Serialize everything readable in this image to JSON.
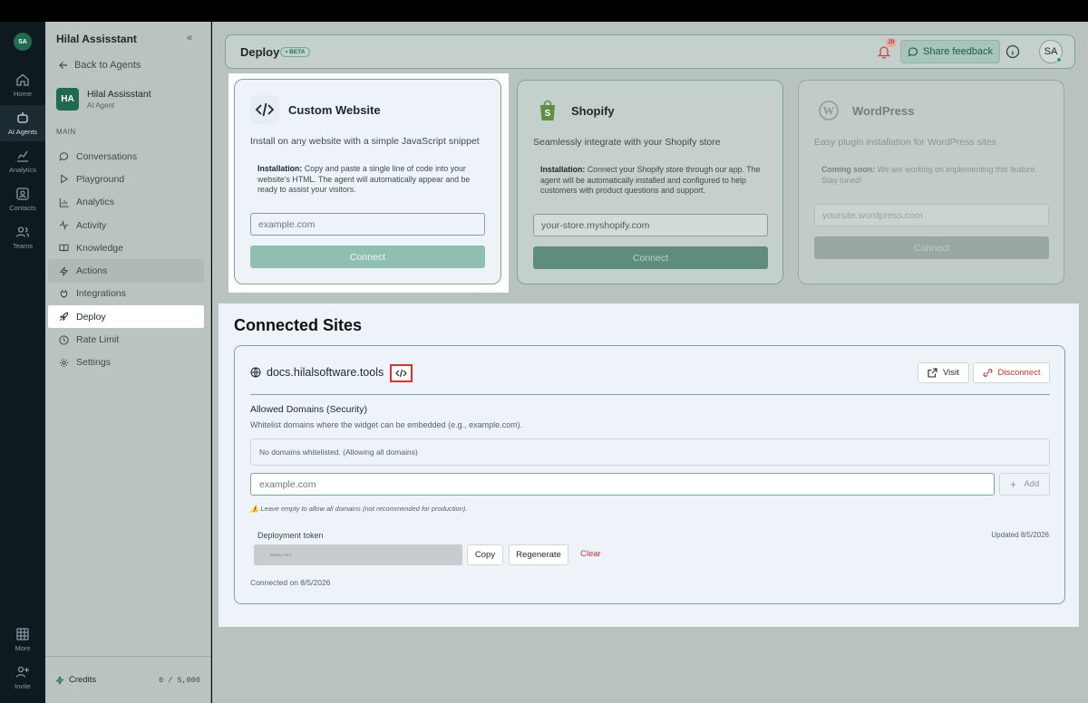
{
  "rail": {
    "logo": "SA",
    "items": [
      {
        "label": "Home",
        "icon": "home-icon"
      },
      {
        "label": "AI Agents",
        "icon": "robot-icon"
      },
      {
        "label": "Analytics",
        "icon": "chart-line-icon"
      },
      {
        "label": "Contacts",
        "icon": "contact-card-icon"
      },
      {
        "label": "Teams",
        "icon": "users-icon"
      },
      {
        "label": "More",
        "icon": "grid-icon"
      },
      {
        "label": "Invite",
        "icon": "user-plus-icon"
      }
    ]
  },
  "sidebar": {
    "title": "Hilal Assisstant",
    "back": "Back to Agents",
    "agent_initials": "HA",
    "agent_name": "Hilal Assisstant",
    "agent_sub": "AI Agent",
    "section": "MAIN",
    "items": [
      {
        "label": "Conversations",
        "icon": "chat-icon"
      },
      {
        "label": "Playground",
        "icon": "play-icon"
      },
      {
        "label": "Analytics",
        "icon": "bar-chart-icon"
      },
      {
        "label": "Activity",
        "icon": "activity-icon"
      },
      {
        "label": "Knowledge",
        "icon": "book-icon"
      },
      {
        "label": "Actions",
        "icon": "lightning-icon"
      },
      {
        "label": "Integrations",
        "icon": "plug-icon"
      },
      {
        "label": "Deploy",
        "icon": "rocket-icon"
      },
      {
        "label": "Rate Limit",
        "icon": "clock-icon"
      },
      {
        "label": "Settings",
        "icon": "gear-icon"
      }
    ],
    "active": "Deploy",
    "credits_label": "Credits",
    "credits_value": "0 / 5,000"
  },
  "header": {
    "title": "Deploy",
    "badge": "• BETA",
    "notification_count": "29",
    "feedback_label": "Share feedback",
    "user_initials": "SA"
  },
  "integrations": [
    {
      "name": "Custom Website",
      "icon": "code-icon",
      "description": "Install on any website with a simple JavaScript snippet",
      "instruction_label": "Installation:",
      "instruction_text": " Copy and paste a single line of code into your website's HTML. The agent will automatically appear and be ready to assist your visitors.",
      "placeholder": "example.com",
      "button": "Connect"
    },
    {
      "name": "Shopify",
      "icon": "shopify-bag-icon",
      "description": "Seamlessly integrate with your Shopify store",
      "instruction_label": "Installation:",
      "instruction_text": " Connect your Shopify store through our app. The agent will be automatically installed and configured to help customers with product questions and support.",
      "placeholder": "your-store.myshopify.com",
      "button": "Connect"
    },
    {
      "name": "WordPress",
      "icon": "wordpress-icon",
      "description": "Easy plugin installation for WordPress sites",
      "instruction_label": "Coming soon:",
      "instruction_text": " We are working on implementing this feature. Stay tuned!",
      "placeholder": "yoursite.wordpress.com",
      "button": "Connect"
    }
  ],
  "connected": {
    "title": "Connected Sites",
    "site": {
      "domain": "docs.hilalsoftware.tools",
      "visit": "Visit",
      "disconnect": "Disconnect",
      "allowed_title": "Allowed Domains (Security)",
      "allowed_sub": "Whitelist domains where the widget can be embedded (e.g., example.com).",
      "no_domains": "No domains whitelisted. (Allowing all domains)",
      "domain_placeholder": "example.com",
      "add": "Add",
      "warning": "⚠️ Leave empty to allow all domains (not recommended for production).",
      "token_label": "Deployment token",
      "token_updated": "Updated 8/5/2026",
      "token_value": "REDACTED",
      "copy": "Copy",
      "regenerate": "Regenerate",
      "clear": "Clear",
      "connected_on": "Connected on 8/5/2026"
    }
  },
  "colors": {
    "brand": "#1f6b4f",
    "danger": "#c2372b",
    "highlight": "#e0302a"
  }
}
